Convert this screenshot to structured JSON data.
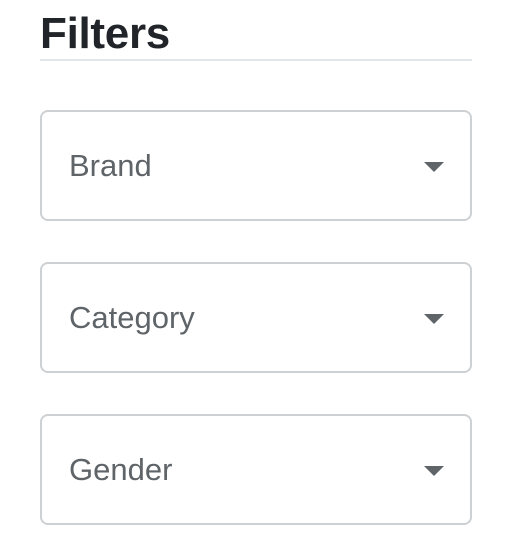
{
  "filters": {
    "title": "Filters",
    "items": [
      {
        "label": "Brand",
        "icon": "chevron-down-icon"
      },
      {
        "label": "Category",
        "icon": "chevron-down-icon"
      },
      {
        "label": "Gender",
        "icon": "chevron-down-icon"
      }
    ]
  },
  "colors": {
    "title_text": "#212529",
    "label_text": "#5f6468",
    "border": "#cdd1d4",
    "divider": "#e3e6e8",
    "background": "#ffffff"
  }
}
